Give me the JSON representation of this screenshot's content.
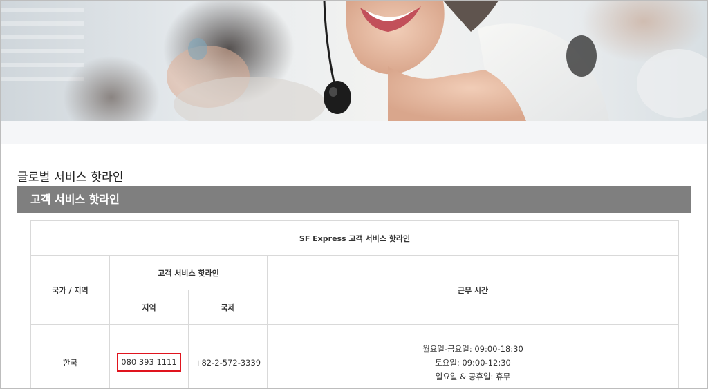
{
  "page": {
    "title": "글로벌 서비스 핫라인"
  },
  "section": {
    "title": "고객 서비스 핫라인"
  },
  "table": {
    "caption": "SF Express 고객 서비스 핫라인",
    "headers": {
      "country_region": "국가 / 지역",
      "hotline_group": "고객 서비스 핫라인",
      "local": "지역",
      "international": "국제",
      "hours": "근무 시간"
    },
    "rows": [
      {
        "country": "한국",
        "local": "080 393 1111",
        "international": "+82-2-572-3339",
        "hours": [
          "월요일-금요일: 09:00-18:30",
          "토요일: 09:00-12:30",
          "일요일 & 공휴일: 휴무"
        ]
      }
    ]
  },
  "colors": {
    "section_bar": "#7f7f7f",
    "highlight_border": "#e0141e",
    "table_border": "#d9d9d9"
  }
}
